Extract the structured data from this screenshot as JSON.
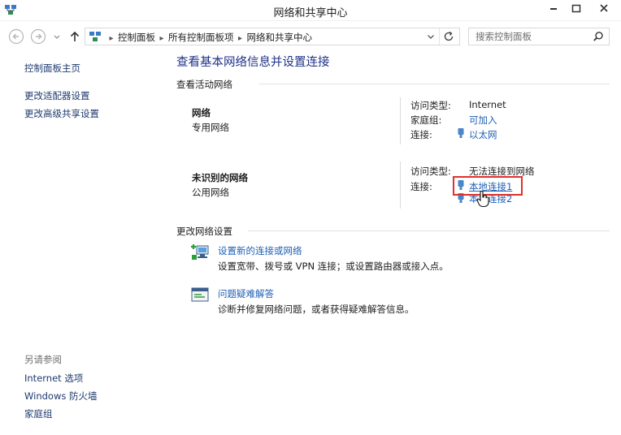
{
  "window": {
    "title": "网络和共享中心"
  },
  "address": {
    "crumbs": [
      "控制面板",
      "所有控制面板项",
      "网络和共享中心"
    ],
    "search_placeholder": "搜索控制面板"
  },
  "sidebar": {
    "items": [
      {
        "label": "控制面板主页"
      },
      {
        "label": "更改适配器设置"
      },
      {
        "label": "更改高级共享设置"
      }
    ],
    "see_also_title": "另请参阅",
    "see_also": [
      {
        "label": "Internet 选项"
      },
      {
        "label": "Windows 防火墙"
      },
      {
        "label": "家庭组"
      }
    ]
  },
  "main": {
    "heading": "查看基本网络信息并设置连接",
    "active_networks_title": "查看活动网络",
    "networks": [
      {
        "name": "网络",
        "type": "专用网络",
        "access_label": "访问类型:",
        "access_value": "Internet",
        "homegroup_label": "家庭组:",
        "homegroup_value": "可加入",
        "connection_label": "连接:",
        "connection_value": "以太网"
      },
      {
        "name": "未识别的网络",
        "type": "公用网络",
        "access_label": "访问类型:",
        "access_value": "无法连接到网络",
        "connection_label": "连接:",
        "connections": [
          "本地连接1",
          "本地连接2"
        ]
      }
    ],
    "change_settings_title": "更改网络设置",
    "tasks": [
      {
        "link": "设置新的连接或网络",
        "desc": "设置宽带、拨号或 VPN 连接；或设置路由器或接入点。"
      },
      {
        "link": "问题疑难解答",
        "desc": "诊断并修复网络问题，或者获得疑难解答信息。"
      }
    ]
  },
  "colors": {
    "heading": "#1e3287",
    "link": "#1e5fb4",
    "highlight": "#e0302e"
  }
}
